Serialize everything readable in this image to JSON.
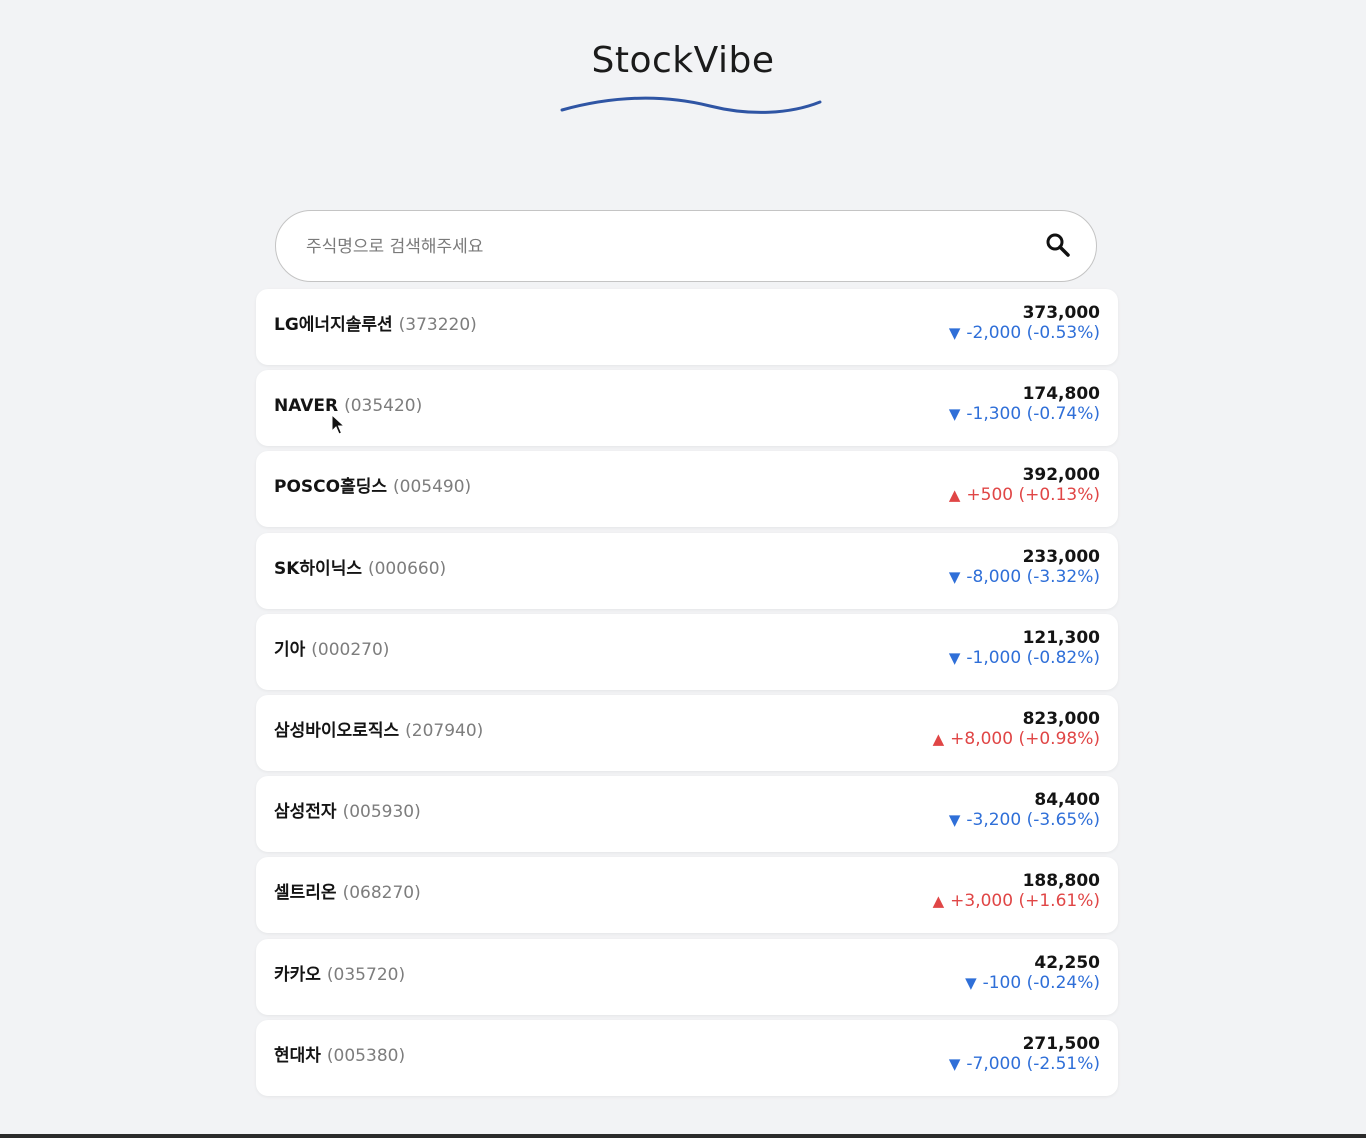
{
  "app": {
    "title": "StockVibe",
    "wave_color": "#2f55a4"
  },
  "search": {
    "placeholder": "주식명으로 검색해주세요",
    "value": "",
    "icon": "search-icon"
  },
  "colors": {
    "background": "#f2f3f5",
    "down": "#2f6fd8",
    "up": "#e04646"
  },
  "stocks": [
    {
      "name": "LG에너지솔루션",
      "code": "(373220)",
      "price": "373,000",
      "direction": "down",
      "arrow": "▼",
      "change": "-2,000 (-0.53%)"
    },
    {
      "name": "NAVER",
      "code": "(035420)",
      "price": "174,800",
      "direction": "down",
      "arrow": "▼",
      "change": "-1,300 (-0.74%)"
    },
    {
      "name": "POSCO홀딩스",
      "code": "(005490)",
      "price": "392,000",
      "direction": "up",
      "arrow": "▲",
      "change": "+500 (+0.13%)"
    },
    {
      "name": "SK하이닉스",
      "code": "(000660)",
      "price": "233,000",
      "direction": "down",
      "arrow": "▼",
      "change": "-8,000 (-3.32%)"
    },
    {
      "name": "기아",
      "code": "(000270)",
      "price": "121,300",
      "direction": "down",
      "arrow": "▼",
      "change": "-1,000 (-0.82%)"
    },
    {
      "name": "삼성바이오로직스",
      "code": "(207940)",
      "price": "823,000",
      "direction": "up",
      "arrow": "▲",
      "change": "+8,000 (+0.98%)"
    },
    {
      "name": "삼성전자",
      "code": "(005930)",
      "price": "84,400",
      "direction": "down",
      "arrow": "▼",
      "change": "-3,200 (-3.65%)"
    },
    {
      "name": "셀트리온",
      "code": "(068270)",
      "price": "188,800",
      "direction": "up",
      "arrow": "▲",
      "change": "+3,000 (+1.61%)"
    },
    {
      "name": "카카오",
      "code": "(035720)",
      "price": "42,250",
      "direction": "down",
      "arrow": "▼",
      "change": "-100 (-0.24%)"
    },
    {
      "name": "현대차",
      "code": "(005380)",
      "price": "271,500",
      "direction": "down",
      "arrow": "▼",
      "change": "-7,000 (-2.51%)"
    }
  ]
}
